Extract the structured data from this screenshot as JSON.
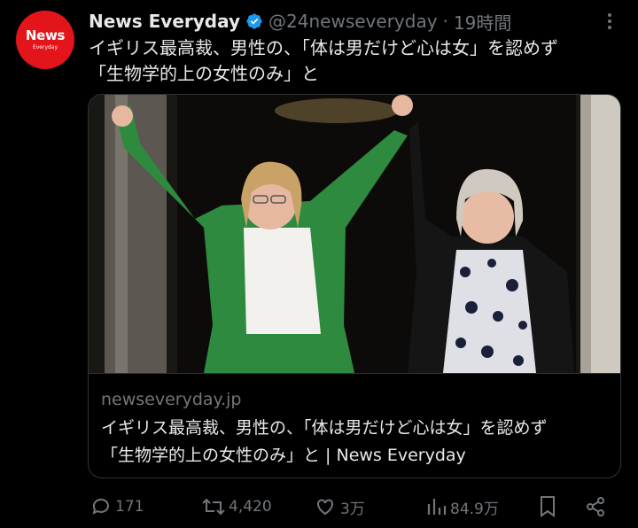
{
  "tweet": {
    "avatar_text_big": "News",
    "avatar_text_small": "Everyday",
    "display_name": "News Everyday",
    "handle": "@24newseveryday",
    "separator": "·",
    "time": "19時間",
    "text_line1": "イギリス最高裁、男性の、「体は男だけど心は女」を認めず",
    "text_line2": "「生物学的上の女性のみ」と"
  },
  "card": {
    "domain": "newseveryday.jp",
    "title_line1": "イギリス最高裁、男性の、「体は男だけど心は女」を認めず",
    "title_line2": "「生物学的上の女性のみ」と | News Everyday"
  },
  "actions": {
    "replies": "171",
    "reposts": "4,420",
    "likes": "3万",
    "views": "84.9万"
  },
  "icons": {
    "verified": "verified-badge-icon",
    "more": "more-icon",
    "reply": "reply-icon",
    "repost": "repost-icon",
    "like": "heart-icon",
    "views": "views-icon",
    "bookmark": "bookmark-icon",
    "share": "share-icon"
  },
  "colors": {
    "background": "#000000",
    "text": "#e7e9ea",
    "muted": "#71767b",
    "verified": "#1d9bf0",
    "avatar": "#e4141b"
  }
}
